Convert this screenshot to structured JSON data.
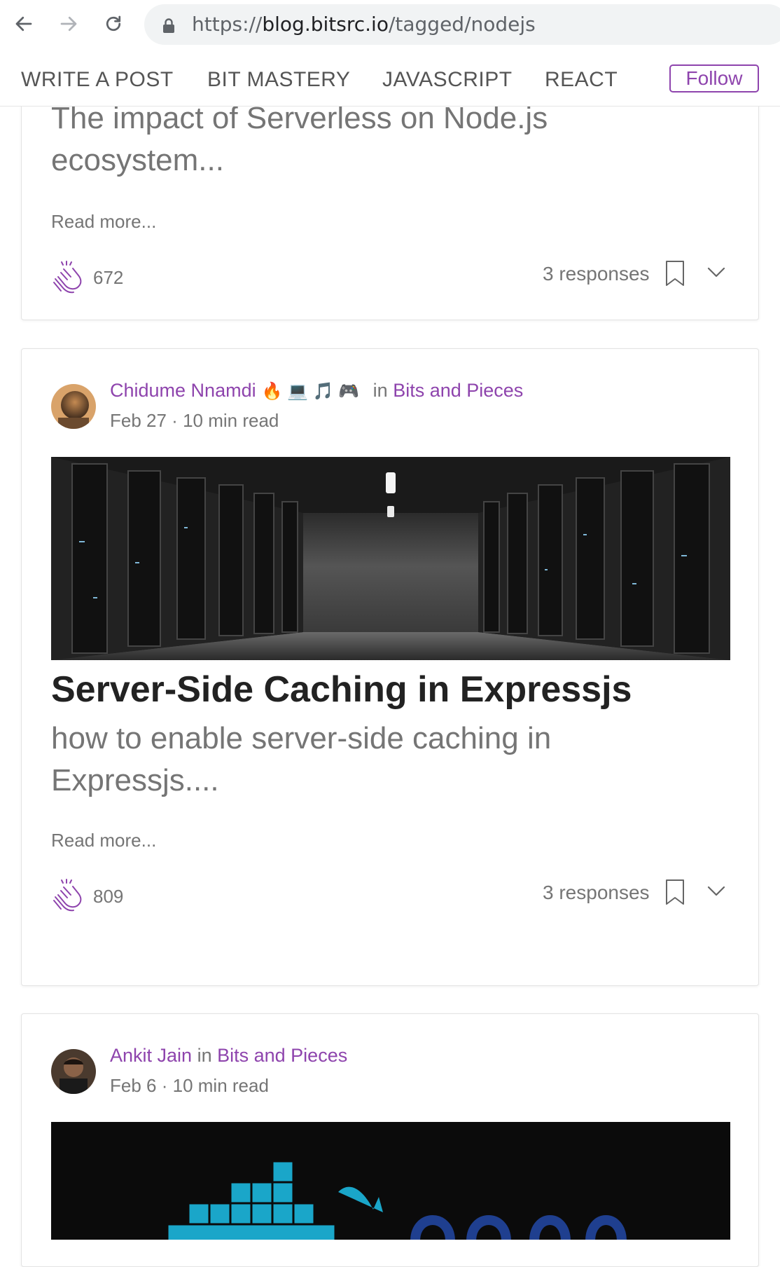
{
  "browser": {
    "url_scheme": "https://",
    "url_host": "blog.bitsrc.io",
    "url_path": "/tagged/nodejs"
  },
  "site_nav": {
    "items": [
      "WRITE A POST",
      "BIT MASTERY",
      "JAVASCRIPT",
      "REACT"
    ],
    "follow_label": "Follow"
  },
  "posts": [
    {
      "subtitle_line1": "The impact of Serverless on Node.js",
      "subtitle_line2": "ecosystem...",
      "read_more": "Read more...",
      "claps": "672",
      "responses": "3 responses"
    },
    {
      "author": "Chidume Nnamdi",
      "author_emojis": "🔥 💻 🎵 🎮",
      "in_label": "in",
      "publication": "Bits and Pieces",
      "date": "Feb 27",
      "read_time": "10 min read",
      "title": "Server-Side Caching in Expressjs",
      "subtitle_line1": "how to enable server-side caching in",
      "subtitle_line2": "Expressjs....",
      "read_more": "Read more...",
      "claps": "809",
      "responses": "3 responses"
    },
    {
      "author": "Ankit Jain",
      "in_label": "in",
      "publication": "Bits and Pieces",
      "date": "Feb 6",
      "read_time": "10 min read"
    }
  ],
  "colors": {
    "accent": "#8e44ad",
    "muted_text": "#757575",
    "title_text": "#222222"
  }
}
